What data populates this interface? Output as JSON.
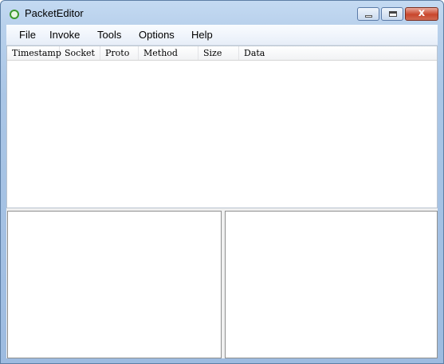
{
  "window": {
    "title": "PacketEditor",
    "icon": "app-ring-icon",
    "caption_buttons": [
      "minimize",
      "maximize",
      "close"
    ],
    "close_glyph": "x"
  },
  "menu": [
    "File",
    "Invoke",
    "Tools",
    "Options",
    "Help"
  ],
  "packet_list": {
    "columns": [
      "Timestamp",
      "Socket",
      "Proto",
      "Method",
      "Size",
      "Data"
    ],
    "rows": []
  }
}
